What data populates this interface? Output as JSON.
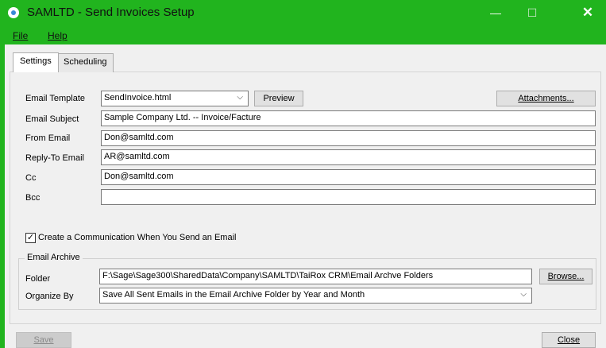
{
  "window": {
    "title": "SAMLTD - Send Invoices Setup",
    "minimize_glyph": "—",
    "maximize_glyph": "☐",
    "close_glyph": "✕",
    "accent_color": "#21b41e"
  },
  "menu": {
    "file": "File",
    "help": "Help"
  },
  "tabs": [
    {
      "label": "Settings",
      "active": true
    },
    {
      "label": "Scheduling",
      "active": false
    }
  ],
  "form": {
    "email_template": {
      "label": "Email Template",
      "value": "SendInvoice.html"
    },
    "preview_button": "Preview",
    "attachments_button": "Attachments...",
    "email_subject": {
      "label": "Email Subject",
      "value": "Sample Company Ltd. -- Invoice/Facture"
    },
    "from_email": {
      "label": "From Email",
      "value": "Don@samltd.com"
    },
    "reply_to_email": {
      "label": "Reply-To Email",
      "value": "AR@samltd.com"
    },
    "cc": {
      "label": "Cc",
      "value": "Don@samltd.com"
    },
    "bcc": {
      "label": "Bcc",
      "value": ""
    },
    "create_communication": {
      "label": "Create a Communication When You Send an Email",
      "checked": true,
      "check_glyph": "✓"
    }
  },
  "archive": {
    "group_label": "Email Archive",
    "folder": {
      "label": "Folder",
      "value": "F:\\Sage\\Sage300\\SharedData\\Company\\SAMLTD\\TaiRox CRM\\Email Archve Folders"
    },
    "browse_button": "Browse...",
    "organize_by": {
      "label": "Organize By",
      "value": "Save All Sent Emails in the Email Archive Folder by Year and Month"
    }
  },
  "footer": {
    "save_button": "Save",
    "close_button": "Close"
  },
  "icons": {
    "dropdown": "chevron-down-icon",
    "chevron_glyph": "⌵"
  }
}
